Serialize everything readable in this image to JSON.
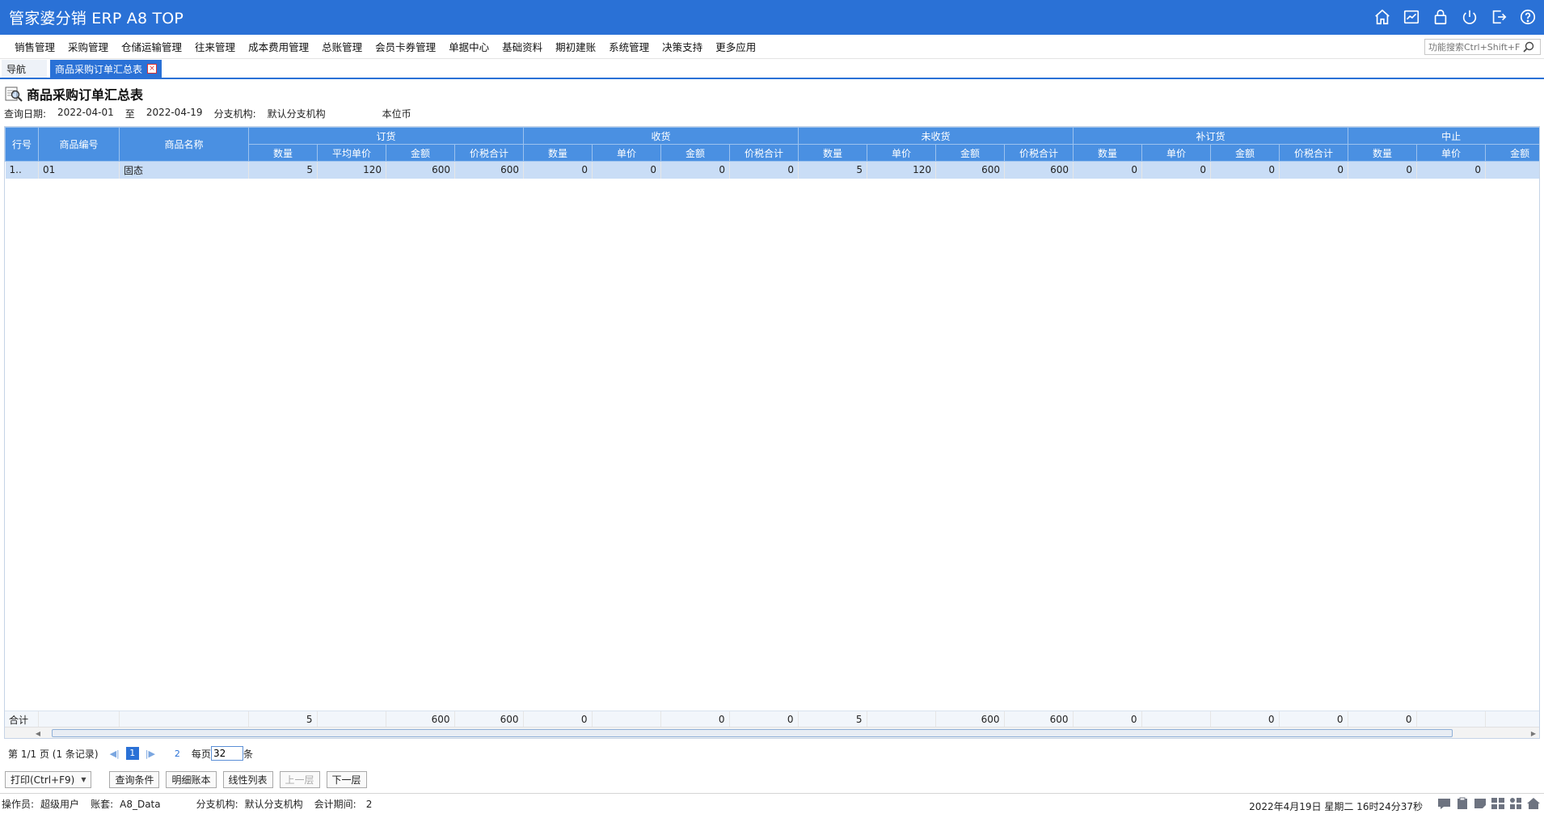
{
  "app": {
    "title": "管家婆分销 ERP A8 TOP"
  },
  "title_icons": [
    "home-icon",
    "chart-icon",
    "lock-icon",
    "power-icon",
    "exit-icon",
    "help-icon"
  ],
  "menu": {
    "items": [
      "销售管理",
      "采购管理",
      "仓储运输管理",
      "往来管理",
      "成本费用管理",
      "总账管理",
      "会员卡券管理",
      "单据中心",
      "基础资料",
      "期初建账",
      "系统管理",
      "决策支持",
      "更多应用"
    ],
    "search_placeholder": "功能搜索Ctrl+Shift+F"
  },
  "tabs": {
    "nav": "导航",
    "active": "商品采购订单汇总表"
  },
  "report": {
    "title": "商品采购订单汇总表",
    "query_date_label": "查询日期:",
    "date_from": "2022-04-01",
    "to_label": "至",
    "date_to": "2022-04-19",
    "branch_label": "分支机构:",
    "branch_value": "默认分支机构",
    "currency": "本位币"
  },
  "grid": {
    "fixed_headers": [
      "行号",
      "商品编号",
      "商品名称"
    ],
    "groups": [
      {
        "label": "订货",
        "cols": [
          "数量",
          "平均单价",
          "金额",
          "价税合计"
        ]
      },
      {
        "label": "收货",
        "cols": [
          "数量",
          "单价",
          "金额",
          "价税合计"
        ]
      },
      {
        "label": "未收货",
        "cols": [
          "数量",
          "单价",
          "金额",
          "价税合计"
        ]
      },
      {
        "label": "补订货",
        "cols": [
          "数量",
          "单价",
          "金额",
          "价税合计"
        ]
      },
      {
        "label": "中止",
        "cols": [
          "数量",
          "单价",
          "金额"
        ]
      }
    ],
    "rows": [
      {
        "rowno": "1..",
        "code": "01",
        "name": "固态",
        "vals": [
          "5",
          "120",
          "600",
          "600",
          "0",
          "0",
          "0",
          "0",
          "5",
          "120",
          "600",
          "600",
          "0",
          "0",
          "0",
          "0",
          "0",
          "0",
          ""
        ]
      }
    ],
    "totals": {
      "label": "合计",
      "vals": [
        "5",
        "",
        "600",
        "600",
        "0",
        "",
        "0",
        "0",
        "5",
        "",
        "600",
        "600",
        "0",
        "",
        "0",
        "0",
        "0",
        "",
        ""
      ]
    }
  },
  "pager": {
    "page_text": "第  1/1 页  (1 条记录)",
    "current": "1",
    "last": "2",
    "per_page_label": "每页",
    "per_page": "32",
    "unit": "条"
  },
  "buttons": {
    "print": "打印(Ctrl+F9)",
    "query": "查询条件",
    "detail": "明细账本",
    "linear": "线性列表",
    "up": "上一层",
    "down": "下一层"
  },
  "status": {
    "operator_label": "操作员:",
    "operator": "超级用户",
    "account_label": "账套:",
    "account": "A8_Data",
    "branch_label": "分支机构:",
    "branch": "默认分支机构",
    "period_label": "会计期间:",
    "period": "2",
    "datetime": "2022年4月19日  星期二  16时24分37秒"
  },
  "colors": {
    "primary": "#2a71d6",
    "header": "#4a90e2",
    "selected_row": "#c9ddf6"
  }
}
